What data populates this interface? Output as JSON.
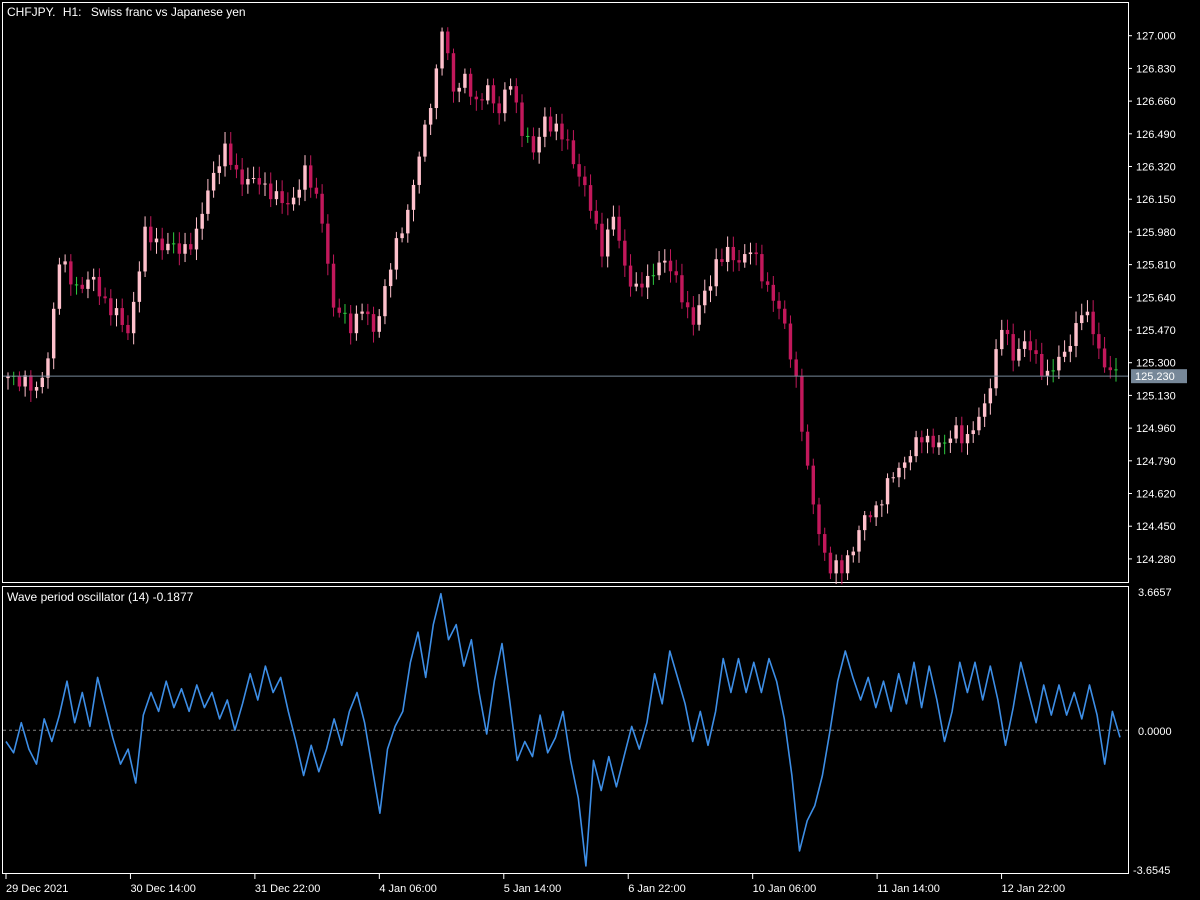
{
  "window": {
    "symbol": "CHFJPY.",
    "timeframe": "H1:",
    "description": "Swiss franc vs Japanese yen"
  },
  "price_panel": {
    "current_price": "125.230",
    "price_labels": [
      "127.000",
      "126.830",
      "126.660",
      "126.490",
      "126.320",
      "126.150",
      "125.980",
      "125.810",
      "125.640",
      "125.470",
      "125.300",
      "125.130",
      "124.960",
      "124.790",
      "124.620",
      "124.450",
      "124.280"
    ]
  },
  "oscillator_panel": {
    "title": "Wave period oscillator (14) -0.1877",
    "labels": [
      "3.6657",
      "0.0000",
      "-3.6545"
    ]
  },
  "time_axis": {
    "labels": [
      "29 Dec 2021",
      "30 Dec 14:00",
      "31 Dec 22:00",
      "4 Jan 06:00",
      "5 Jan 14:00",
      "6 Jan 22:00",
      "10 Jan 06:00",
      "11 Jan 14:00",
      "12 Jan 22:00"
    ]
  },
  "colors": {
    "background": "#000000",
    "bear_candle": "#c2185b",
    "bull_candle": "#ffc1cc",
    "doji_candle": "#2ecc40",
    "oscillator_line": "#3d8ee6",
    "current_price_line": "#778899",
    "panel_border": "#ffffff",
    "zero_line": "#808080"
  },
  "chart_data": [
    {
      "type": "candlestick",
      "title": "CHFJPY., H1:  Swiss franc vs Japanese yen",
      "x_start": "29 Dec 2021",
      "x_ticks": [
        "29 Dec 2021",
        "30 Dec 14:00",
        "31 Dec 22:00",
        "4 Jan 06:00",
        "5 Jan 14:00",
        "6 Jan 22:00",
        "10 Jan 06:00",
        "11 Jan 14:00",
        "12 Jan 22:00"
      ],
      "ylim": [
        124.16,
        127.17
      ],
      "current_price": 125.23,
      "close_keypoints": [
        [
          0,
          125.21
        ],
        [
          3,
          125.22
        ],
        [
          5,
          125.13
        ],
        [
          7,
          125.34
        ],
        [
          9,
          125.82
        ],
        [
          12,
          125.7
        ],
        [
          15,
          125.72
        ],
        [
          18,
          125.58
        ],
        [
          21,
          125.46
        ],
        [
          24,
          125.96
        ],
        [
          27,
          125.92
        ],
        [
          30,
          125.88
        ],
        [
          33,
          125.96
        ],
        [
          36,
          126.3
        ],
        [
          38,
          126.4
        ],
        [
          40,
          126.28
        ],
        [
          43,
          126.24
        ],
        [
          46,
          126.2
        ],
        [
          49,
          126.1
        ],
        [
          52,
          126.3
        ],
        [
          55,
          126.06
        ],
        [
          57,
          125.58
        ],
        [
          60,
          125.5
        ],
        [
          62,
          125.58
        ],
        [
          64,
          125.46
        ],
        [
          67,
          125.8
        ],
        [
          70,
          126.1
        ],
        [
          73,
          126.5
        ],
        [
          75,
          126.82
        ],
        [
          76,
          127.05
        ],
        [
          78,
          126.7
        ],
        [
          80,
          126.8
        ],
        [
          82,
          126.62
        ],
        [
          84,
          126.74
        ],
        [
          86,
          126.6
        ],
        [
          88,
          126.76
        ],
        [
          90,
          126.52
        ],
        [
          92,
          126.38
        ],
        [
          94,
          126.58
        ],
        [
          96,
          126.5
        ],
        [
          98,
          126.44
        ],
        [
          100,
          126.28
        ],
        [
          102,
          126.1
        ],
        [
          104,
          125.9
        ],
        [
          106,
          126.05
        ],
        [
          108,
          125.8
        ],
        [
          110,
          125.68
        ],
        [
          112,
          125.72
        ],
        [
          114,
          125.84
        ],
        [
          116,
          125.78
        ],
        [
          118,
          125.66
        ],
        [
          120,
          125.5
        ],
        [
          122,
          125.66
        ],
        [
          124,
          125.82
        ],
        [
          126,
          125.86
        ],
        [
          128,
          125.84
        ],
        [
          130,
          125.88
        ],
        [
          132,
          125.76
        ],
        [
          134,
          125.64
        ],
        [
          136,
          125.48
        ],
        [
          138,
          125.22
        ],
        [
          140,
          124.72
        ],
        [
          142,
          124.42
        ],
        [
          144,
          124.22
        ],
        [
          146,
          124.23
        ],
        [
          148,
          124.35
        ],
        [
          150,
          124.48
        ],
        [
          152,
          124.55
        ],
        [
          154,
          124.66
        ],
        [
          156,
          124.75
        ],
        [
          158,
          124.84
        ],
        [
          160,
          124.9
        ],
        [
          162,
          124.9
        ],
        [
          164,
          124.86
        ],
        [
          166,
          124.96
        ],
        [
          168,
          124.9
        ],
        [
          170,
          125.0
        ],
        [
          172,
          125.2
        ],
        [
          174,
          125.48
        ],
        [
          176,
          125.35
        ],
        [
          178,
          125.4
        ],
        [
          180,
          125.32
        ],
        [
          182,
          125.24
        ],
        [
          184,
          125.3
        ],
        [
          186,
          125.42
        ],
        [
          188,
          125.56
        ],
        [
          190,
          125.48
        ],
        [
          192,
          125.28
        ],
        [
          194,
          125.23
        ]
      ]
    },
    {
      "type": "line",
      "title": "Wave period oscillator (14) -0.1877",
      "ylim": [
        -3.6545,
        3.6657
      ],
      "zero_line": 0.0,
      "last_value": -0.1877,
      "points": [
        [
          0,
          -0.3
        ],
        [
          1,
          -0.6
        ],
        [
          2,
          0.2
        ],
        [
          3,
          -0.5
        ],
        [
          4,
          -0.9
        ],
        [
          5,
          0.3
        ],
        [
          6,
          -0.3
        ],
        [
          7,
          0.4
        ],
        [
          8,
          1.3
        ],
        [
          9,
          0.2
        ],
        [
          10,
          1.0
        ],
        [
          11,
          0.1
        ],
        [
          12,
          1.4
        ],
        [
          13,
          0.6
        ],
        [
          14,
          -0.2
        ],
        [
          15,
          -0.9
        ],
        [
          16,
          -0.5
        ],
        [
          17,
          -1.4
        ],
        [
          18,
          0.4
        ],
        [
          19,
          1.0
        ],
        [
          20,
          0.5
        ],
        [
          21,
          1.3
        ],
        [
          22,
          0.6
        ],
        [
          23,
          1.1
        ],
        [
          24,
          0.5
        ],
        [
          25,
          1.2
        ],
        [
          26,
          0.6
        ],
        [
          27,
          1.0
        ],
        [
          28,
          0.3
        ],
        [
          29,
          0.8
        ],
        [
          30,
          0.0
        ],
        [
          31,
          0.7
        ],
        [
          32,
          1.5
        ],
        [
          33,
          0.8
        ],
        [
          34,
          1.7
        ],
        [
          35,
          1.0
        ],
        [
          36,
          1.4
        ],
        [
          37,
          0.5
        ],
        [
          38,
          -0.3
        ],
        [
          39,
          -1.2
        ],
        [
          40,
          -0.4
        ],
        [
          41,
          -1.1
        ],
        [
          42,
          -0.5
        ],
        [
          43,
          0.3
        ],
        [
          44,
          -0.4
        ],
        [
          45,
          0.5
        ],
        [
          46,
          1.0
        ],
        [
          47,
          0.2
        ],
        [
          48,
          -1.0
        ],
        [
          49,
          -2.2
        ],
        [
          50,
          -0.5
        ],
        [
          51,
          0.1
        ],
        [
          52,
          0.5
        ],
        [
          53,
          1.8
        ],
        [
          54,
          2.6
        ],
        [
          55,
          1.4
        ],
        [
          56,
          2.8
        ],
        [
          57,
          3.62
        ],
        [
          58,
          2.4
        ],
        [
          59,
          2.8
        ],
        [
          60,
          1.7
        ],
        [
          61,
          2.4
        ],
        [
          62,
          1.0
        ],
        [
          63,
          -0.1
        ],
        [
          64,
          1.3
        ],
        [
          65,
          2.3
        ],
        [
          66,
          0.8
        ],
        [
          67,
          -0.8
        ],
        [
          68,
          -0.3
        ],
        [
          69,
          -0.7
        ],
        [
          70,
          0.4
        ],
        [
          71,
          -0.6
        ],
        [
          72,
          -0.2
        ],
        [
          73,
          0.5
        ],
        [
          74,
          -0.8
        ],
        [
          75,
          -1.8
        ],
        [
          76,
          -3.6
        ],
        [
          77,
          -0.8
        ],
        [
          78,
          -1.6
        ],
        [
          79,
          -0.7
        ],
        [
          80,
          -1.5
        ],
        [
          81,
          -0.7
        ],
        [
          82,
          0.1
        ],
        [
          83,
          -0.5
        ],
        [
          84,
          0.2
        ],
        [
          85,
          1.5
        ],
        [
          86,
          0.7
        ],
        [
          87,
          2.1
        ],
        [
          88,
          1.4
        ],
        [
          89,
          0.7
        ],
        [
          90,
          -0.3
        ],
        [
          91,
          0.5
        ],
        [
          92,
          -0.4
        ],
        [
          93,
          0.5
        ],
        [
          94,
          1.9
        ],
        [
          95,
          1.0
        ],
        [
          96,
          1.9
        ],
        [
          97,
          1.0
        ],
        [
          98,
          1.8
        ],
        [
          99,
          1.0
        ],
        [
          100,
          1.9
        ],
        [
          101,
          1.3
        ],
        [
          102,
          0.3
        ],
        [
          103,
          -1.2
        ],
        [
          104,
          -3.2
        ],
        [
          105,
          -2.4
        ],
        [
          106,
          -2.0
        ],
        [
          107,
          -1.2
        ],
        [
          108,
          0.0
        ],
        [
          109,
          1.3
        ],
        [
          110,
          2.1
        ],
        [
          111,
          1.4
        ],
        [
          112,
          0.8
        ],
        [
          113,
          1.4
        ],
        [
          114,
          0.6
        ],
        [
          115,
          1.3
        ],
        [
          116,
          0.5
        ],
        [
          117,
          1.5
        ],
        [
          118,
          0.7
        ],
        [
          119,
          1.8
        ],
        [
          120,
          0.6
        ],
        [
          121,
          1.7
        ],
        [
          122,
          0.8
        ],
        [
          123,
          -0.3
        ],
        [
          124,
          0.5
        ],
        [
          125,
          1.8
        ],
        [
          126,
          1.0
        ],
        [
          127,
          1.8
        ],
        [
          128,
          0.8
        ],
        [
          129,
          1.7
        ],
        [
          130,
          0.8
        ],
        [
          131,
          -0.4
        ],
        [
          132,
          0.6
        ],
        [
          133,
          1.8
        ],
        [
          134,
          1.0
        ],
        [
          135,
          0.2
        ],
        [
          136,
          1.2
        ],
        [
          137,
          0.4
        ],
        [
          138,
          1.2
        ],
        [
          139,
          0.4
        ],
        [
          140,
          1.0
        ],
        [
          141,
          0.3
        ],
        [
          142,
          1.2
        ],
        [
          143,
          0.4
        ],
        [
          144,
          -0.9
        ],
        [
          145,
          0.5
        ],
        [
          146,
          -0.19
        ]
      ]
    }
  ]
}
